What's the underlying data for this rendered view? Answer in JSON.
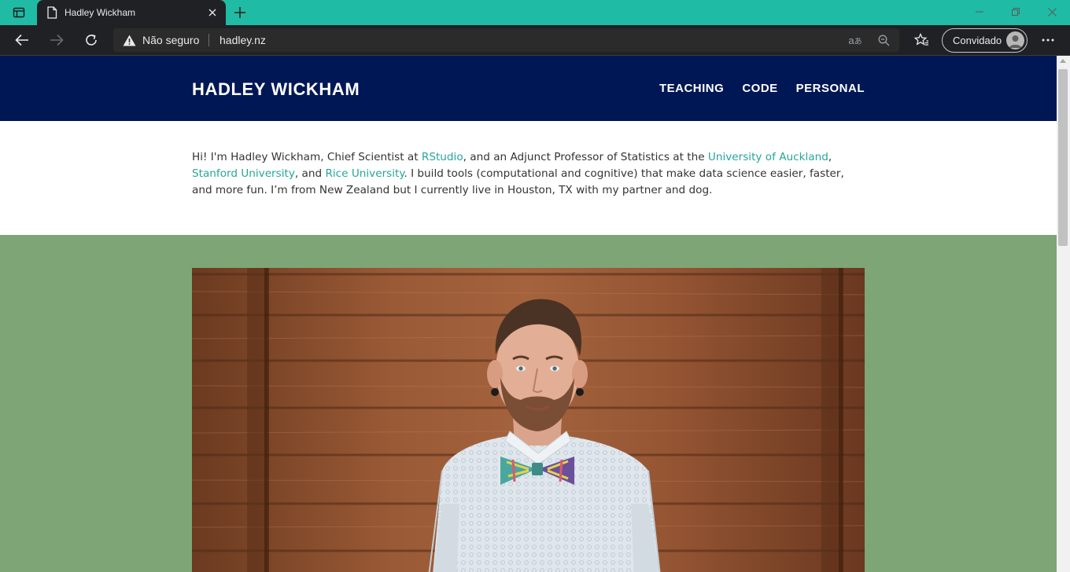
{
  "browser": {
    "tab_title": "Hadley Wickham",
    "security_label": "Não seguro",
    "url": "hadley.nz",
    "profile_label": "Convidado",
    "accent_color": "#20bba5"
  },
  "site": {
    "title": "HADLEY WICKHAM",
    "nav": [
      "TEACHING",
      "CODE",
      "PERSONAL"
    ],
    "header_color": "#001755",
    "link_color": "#26a69a",
    "background_color": "#7ea576",
    "intro": {
      "t1": "Hi! I'm Hadley Wickham, Chief Scientist at ",
      "link1": "RStudio",
      "t2": ", and an Adjunct Professor of Statistics at the ",
      "link2": "University of Auckland",
      "t3": ", ",
      "link3": "Stanford University",
      "t4": ", and ",
      "link4": "Rice University",
      "t5": ". I build tools (computational and cognitive) that make data science easier, faster, and more fun. I’m from New Zealand but I currently live in Houston, TX with my partner and dog."
    }
  }
}
